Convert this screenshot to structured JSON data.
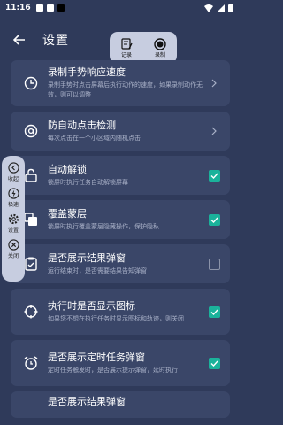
{
  "status_bar": {
    "time": "11:16"
  },
  "header": {
    "title": "设置"
  },
  "record_panel": {
    "record_label": "记录",
    "recording_label": "录制"
  },
  "side_panel": {
    "collapse": "收起",
    "speed": "极速",
    "settings": "设置",
    "close": "关闭"
  },
  "settings": [
    {
      "title": "录制手势响应速度",
      "desc": "录制手势时点击屏幕后执行动作的速度，如果录制动作无效，则可以调整"
    },
    {
      "title": "防自动点击检测",
      "desc": "每次点击在一个小区域内随机点击"
    },
    {
      "title": "自动解锁",
      "desc": "锁屏时执行任务自动解锁屏幕",
      "checked": true
    },
    {
      "title": "覆盖蒙层",
      "desc": "锁屏时执行覆盖蒙层隐藏操作，保护隐私",
      "checked": true
    },
    {
      "title": "是否展示结果弹窗",
      "desc": "运行结束时，是否需要结果告知弹窗",
      "checked": false
    },
    {
      "title": "执行时是否显示图标",
      "desc": "如果您不想在执行任务时显示图标和轨迹，则关闭",
      "checked": true
    },
    {
      "title": "是否展示定时任务弹窗",
      "desc": "定时任务触发时，是否展示提示弹窗，延时执行",
      "checked": true
    },
    {
      "title": "是否展示结果弹窗",
      "desc": ""
    }
  ]
}
